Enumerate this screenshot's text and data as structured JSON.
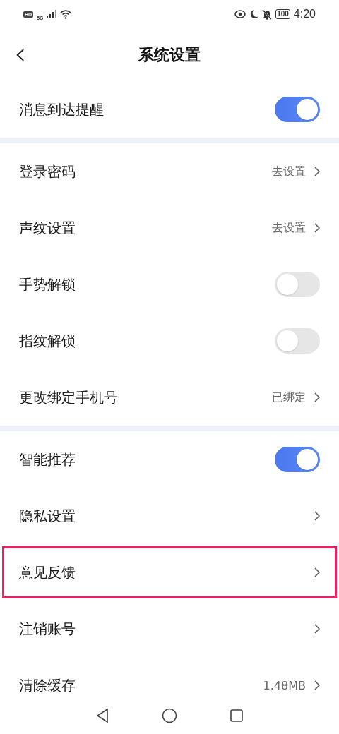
{
  "status_bar": {
    "network_badge": "HD",
    "signal_label": "5G",
    "battery": "100",
    "time": "4:20"
  },
  "header": {
    "back": "‹",
    "title": "系统设置"
  },
  "groups": [
    {
      "rows": [
        {
          "kind": "toggle",
          "label": "消息到达提醒",
          "on": true,
          "highlighted": false
        }
      ]
    },
    {
      "rows": [
        {
          "kind": "link",
          "label": "登录密码",
          "value": "去设置",
          "highlighted": false
        },
        {
          "kind": "link",
          "label": "声纹设置",
          "value": "去设置",
          "highlighted": false
        },
        {
          "kind": "toggle",
          "label": "手势解锁",
          "on": false,
          "highlighted": false
        },
        {
          "kind": "toggle",
          "label": "指纹解锁",
          "on": false,
          "highlighted": false
        },
        {
          "kind": "link",
          "label": "更改绑定手机号",
          "value": "已绑定",
          "highlighted": false
        }
      ]
    },
    {
      "rows": [
        {
          "kind": "toggle",
          "label": "智能推荐",
          "on": true,
          "highlighted": false
        },
        {
          "kind": "link",
          "label": "隐私设置",
          "highlighted": false
        },
        {
          "kind": "link",
          "label": "意见反馈",
          "highlighted": true
        },
        {
          "kind": "link",
          "label": "注销账号",
          "highlighted": false
        },
        {
          "kind": "link",
          "label": "清除缓存",
          "value": "1.48MB",
          "highlighted": false
        }
      ]
    }
  ]
}
